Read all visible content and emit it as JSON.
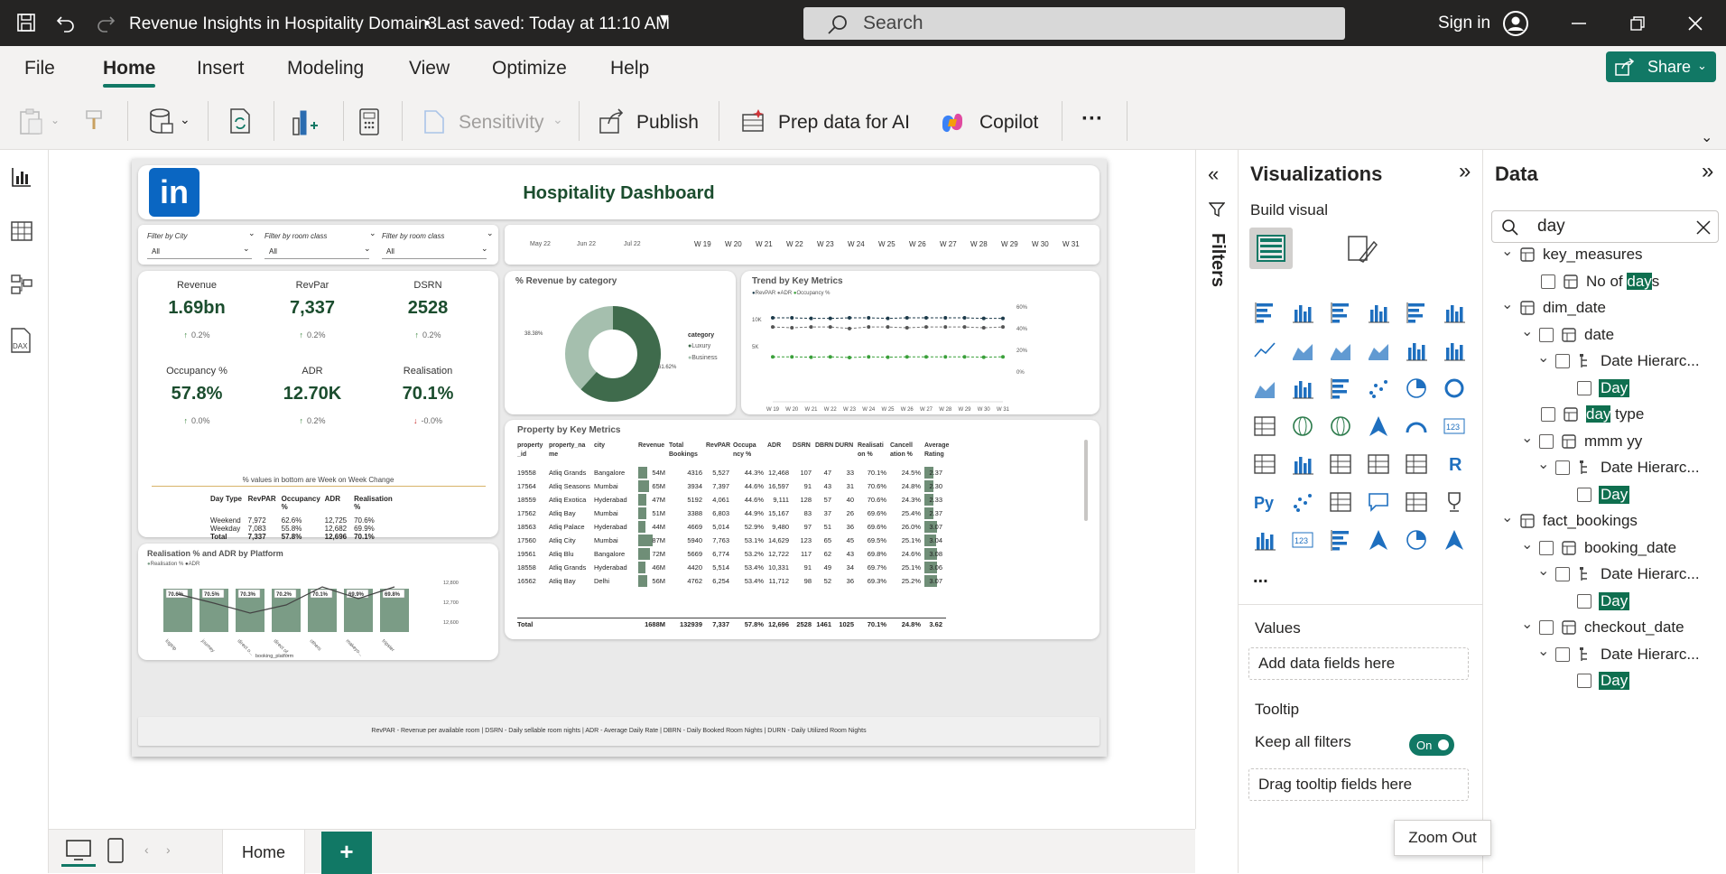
{
  "titlebar": {
    "doc_title": "Revenue Insights in Hospitality Domain3",
    "saved": "Last saved: Today at 11:10 AM",
    "search_placeholder": "Search",
    "signin": "Sign in"
  },
  "menu": [
    "File",
    "Home",
    "Insert",
    "Modeling",
    "View",
    "Optimize",
    "Help"
  ],
  "share_label": "Share",
  "ribbon": {
    "sensitivity": "Sensitivity",
    "publish": "Publish",
    "prep": "Prep data for AI",
    "copilot": "Copilot",
    "more": "···"
  },
  "report": {
    "title": "Hospitality Dashboard",
    "logo_text": "in",
    "filters": [
      {
        "label": "Filter by City",
        "value": "All"
      },
      {
        "label": "Filter by room class",
        "value": "All"
      },
      {
        "label": "Filter by room class",
        "value": "All"
      }
    ],
    "timeline_months": [
      "May 22",
      "Jun 22",
      "Jul 22"
    ],
    "weeks": [
      "W 19",
      "W 20",
      "W 21",
      "W 22",
      "W 23",
      "W 24",
      "W 25",
      "W 26",
      "W 27",
      "W 28",
      "W 29",
      "W 30",
      "W 31"
    ],
    "kpis": [
      {
        "label": "Revenue",
        "value": "1.69bn",
        "change": "0.2%",
        "dir": "up"
      },
      {
        "label": "RevPar",
        "value": "7,337",
        "change": "0.2%",
        "dir": "up"
      },
      {
        "label": "DSRN",
        "value": "2528",
        "change": "0.2%",
        "dir": "up"
      },
      {
        "label": "Occupancy %",
        "value": "57.8%",
        "change": "0.0%",
        "dir": "up"
      },
      {
        "label": "ADR",
        "value": "12.70K",
        "change": "0.2%",
        "dir": "up"
      },
      {
        "label": "Realisation",
        "value": "70.1%",
        "change": "-0.0%",
        "dir": "down"
      }
    ],
    "kpi_note": "% values in bottom are Week on Week Change",
    "daytype_table": {
      "headers": [
        "Day Type",
        "RevPAR",
        "Occupancy %",
        "ADR",
        "Realisation %"
      ],
      "rows": [
        [
          "Weekend",
          "7,972",
          "62.6%",
          "12,725",
          "70.6%"
        ],
        [
          "Weekday",
          "7,083",
          "55.8%",
          "12,682",
          "69.9%"
        ],
        [
          "Total",
          "7,337",
          "57.8%",
          "12,696",
          "70.1%"
        ]
      ]
    },
    "donut": {
      "title": "% Revenue by category",
      "legend_title": "category",
      "legend": [
        "Luxury",
        "Business"
      ],
      "label_left": "38.38%",
      "label_right": "61.62%"
    },
    "trend": {
      "title": "Trend by Key Metrics",
      "legend": [
        "RevPAR",
        "ADR",
        "Occupancy %"
      ],
      "y_left": [
        "10K",
        "5K"
      ],
      "y_right": [
        "60%",
        "40%",
        "20%",
        "0%"
      ]
    },
    "platform": {
      "title": "Realisation % and ADR by Platform",
      "legend": [
        "Realisation %",
        "ADR"
      ],
      "xlabel": "booking_platform",
      "y_right": [
        "12,800",
        "12,700",
        "12,600"
      ]
    },
    "property": {
      "title": "Property by Key Metrics",
      "headers": [
        "property_id",
        "property_name",
        "city",
        "Revenue",
        "Total Bookings",
        "RevPAR",
        "Occupancy %",
        "ADR",
        "DSRN",
        "DBRN",
        "DURN",
        "Realisation %",
        "Cancellation %",
        "Average Rating"
      ],
      "rows": [
        [
          "19558",
          "Atliq Grands",
          "Bangalore",
          "54M",
          "4316",
          "5,527",
          "44.3%",
          "12,468",
          "107",
          "47",
          "33",
          "70.1%",
          "24.5%",
          "2.37"
        ],
        [
          "17564",
          "Atliq Seasons",
          "Mumbai",
          "65M",
          "3934",
          "7,397",
          "44.6%",
          "16,597",
          "91",
          "43",
          "31",
          "70.6%",
          "24.8%",
          "2.30"
        ],
        [
          "18559",
          "Atliq Exotica",
          "Hyderabad",
          "47M",
          "5192",
          "4,061",
          "44.6%",
          "9,111",
          "128",
          "57",
          "40",
          "70.6%",
          "24.3%",
          "2.33"
        ],
        [
          "17562",
          "Atliq Bay",
          "Mumbai",
          "51M",
          "3388",
          "6,803",
          "44.9%",
          "15,167",
          "83",
          "37",
          "26",
          "69.6%",
          "25.4%",
          "2.37"
        ],
        [
          "18563",
          "Atliq Palace",
          "Hyderabad",
          "44M",
          "4669",
          "5,014",
          "52.9%",
          "9,480",
          "97",
          "51",
          "36",
          "69.6%",
          "26.0%",
          "3.07"
        ],
        [
          "17560",
          "Atliq City",
          "Mumbai",
          "87M",
          "5940",
          "7,763",
          "53.1%",
          "14,629",
          "123",
          "65",
          "45",
          "69.5%",
          "25.1%",
          "3.04"
        ],
        [
          "19561",
          "Atliq Blu",
          "Bangalore",
          "72M",
          "5669",
          "6,774",
          "53.2%",
          "12,722",
          "117",
          "62",
          "43",
          "69.8%",
          "24.6%",
          "3.08"
        ],
        [
          "18558",
          "Atliq Grands",
          "Hyderabad",
          "46M",
          "4420",
          "5,514",
          "53.4%",
          "10,331",
          "91",
          "49",
          "34",
          "69.7%",
          "25.1%",
          "3.06"
        ],
        [
          "16562",
          "Atliq Bay",
          "Delhi",
          "56M",
          "4762",
          "6,254",
          "53.4%",
          "11,712",
          "98",
          "52",
          "36",
          "69.3%",
          "25.2%",
          "3.07"
        ]
      ],
      "total": [
        "Total",
        "",
        "",
        "1688M",
        "132939",
        "7,337",
        "57.8%",
        "12,696",
        "2528",
        "1461",
        "1025",
        "70.1%",
        "24.8%",
        "3.62"
      ]
    },
    "footer": "RevPAR - Revenue per available room | DSRN - Daily sellable room nights | ADR - Average Daily Rate | DBRN - Daily Booked Room Nights | DURN - Daily Utilized Room Nights"
  },
  "filters_label": "Filters",
  "viz": {
    "title": "Visualizations",
    "build": "Build visual",
    "more": "...",
    "values": "Values",
    "add_fields": "Add data fields here",
    "tooltip": "Tooltip",
    "keep_filters": "Keep all filters",
    "toggle": "On",
    "drag_tooltip": "Drag tooltip fields here"
  },
  "data": {
    "title": "Data",
    "search_value": "day",
    "tree": [
      {
        "label": "key_measures",
        "level": 0
      },
      {
        "label": "No of days",
        "level": 1
      },
      {
        "label": "dim_date",
        "level": 0
      },
      {
        "label": "date",
        "level": 1
      },
      {
        "label": "Date Hierarc...",
        "level": 2
      },
      {
        "label": "Day",
        "level": 3
      },
      {
        "label": "day type",
        "level": 1
      },
      {
        "label": "mmm yy",
        "level": 1
      },
      {
        "label": "Date Hierarc...",
        "level": 2
      },
      {
        "label": "Day",
        "level": 3
      },
      {
        "label": "fact_bookings",
        "level": 0
      },
      {
        "label": "booking_date",
        "level": 1
      },
      {
        "label": "Date Hierarc...",
        "level": 2
      },
      {
        "label": "Day",
        "level": 3
      },
      {
        "label": "checkout_date",
        "level": 1
      },
      {
        "label": "Date Hierarc...",
        "level": 2
      },
      {
        "label": "Day",
        "level": 3
      }
    ]
  },
  "bottom": {
    "tab": "Home",
    "zoom_tooltip": "Zoom Out"
  }
}
